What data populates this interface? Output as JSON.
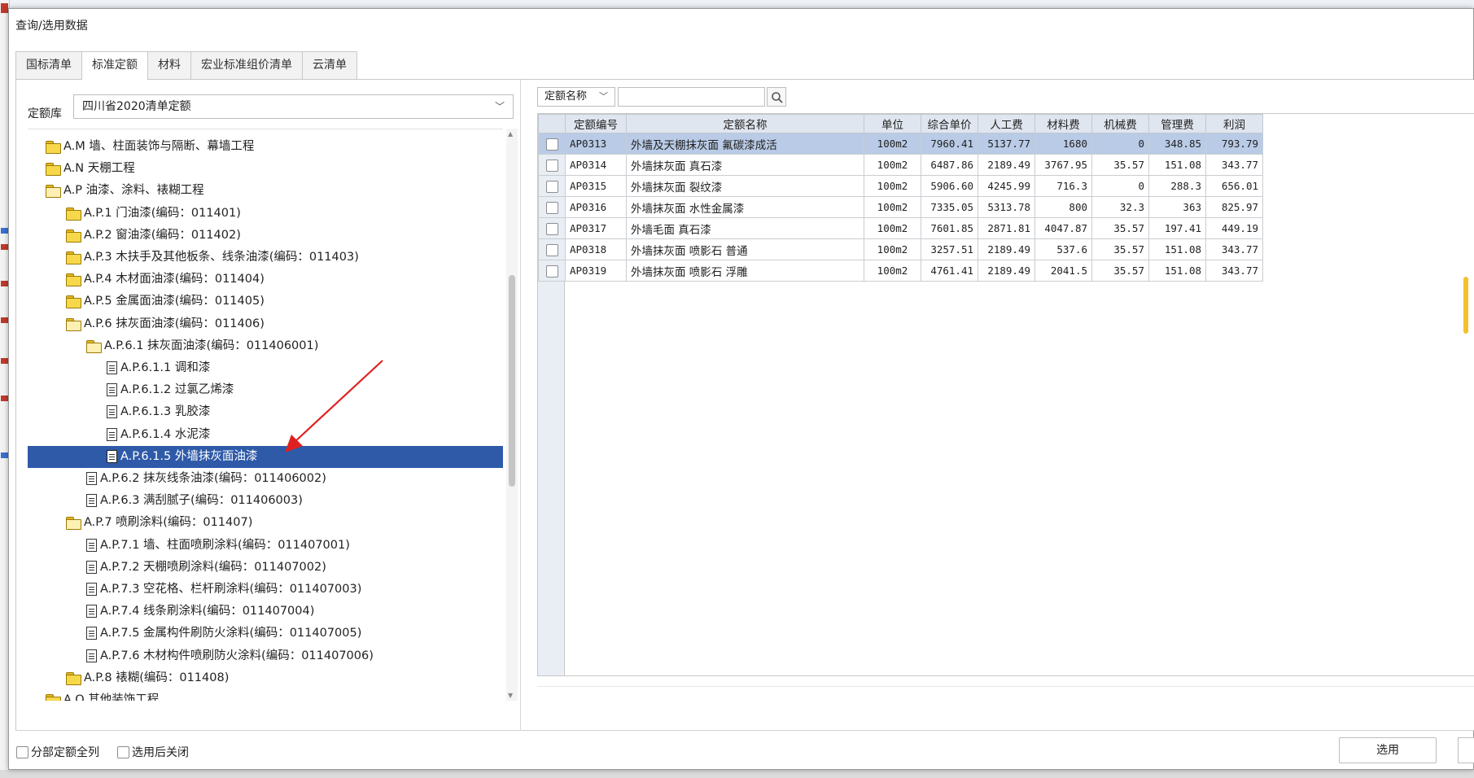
{
  "dialog": {
    "title": "查询/选用数据",
    "tabs": [
      "国标清单",
      "标准定额",
      "材料",
      "宏业标准组价清单",
      "云清单"
    ],
    "active_tab": 1
  },
  "left": {
    "lib_label": "定额库",
    "lib_value": "四川省2020清单定额",
    "tree": [
      {
        "label": "A.M 墙、柱面装饰与隔断、幕墙工程",
        "icon": "folder-closed-icon",
        "level": 1
      },
      {
        "label": "A.N 天棚工程",
        "icon": "folder-closed-icon",
        "level": 1
      },
      {
        "label": "A.P 油漆、涂料、裱糊工程",
        "icon": "folder-open-icon",
        "level": 1
      },
      {
        "label": "A.P.1 门油漆(编码：011401)",
        "icon": "folder-closed-icon",
        "level": 2
      },
      {
        "label": "A.P.2 窗油漆(编码：011402)",
        "icon": "folder-closed-icon",
        "level": 2
      },
      {
        "label": "A.P.3 木扶手及其他板条、线条油漆(编码：011403)",
        "icon": "folder-closed-icon",
        "level": 2
      },
      {
        "label": "A.P.4 木材面油漆(编码：011404)",
        "icon": "folder-closed-icon",
        "level": 2
      },
      {
        "label": "A.P.5 金属面油漆(编码：011405)",
        "icon": "folder-closed-icon",
        "level": 2
      },
      {
        "label": "A.P.6 抹灰面油漆(编码：011406)",
        "icon": "folder-open-icon",
        "level": 2
      },
      {
        "label": "A.P.6.1 抹灰面油漆(编码：011406001)",
        "icon": "folder-open-icon",
        "level": 3
      },
      {
        "label": "A.P.6.1.1 调和漆",
        "icon": "document-icon",
        "level": 4
      },
      {
        "label": "A.P.6.1.2 过氯乙烯漆",
        "icon": "document-icon",
        "level": 4
      },
      {
        "label": "A.P.6.1.3 乳胶漆",
        "icon": "document-icon",
        "level": 4
      },
      {
        "label": "A.P.6.1.4 水泥漆",
        "icon": "document-icon",
        "level": 4
      },
      {
        "label": "A.P.6.1.5 外墙抹灰面油漆",
        "icon": "document-icon",
        "level": 4,
        "selected": true
      },
      {
        "label": "A.P.6.2 抹灰线条油漆(编码：011406002)",
        "icon": "document-icon",
        "level": 3
      },
      {
        "label": "A.P.6.3 满刮腻子(编码：011406003)",
        "icon": "document-icon",
        "level": 3
      },
      {
        "label": "A.P.7 喷刷涂料(编码：011407)",
        "icon": "folder-open-icon",
        "level": 2
      },
      {
        "label": "A.P.7.1 墙、柱面喷刷涂料(编码：011407001)",
        "icon": "document-icon",
        "level": 3
      },
      {
        "label": "A.P.7.2 天棚喷刷涂料(编码：011407002)",
        "icon": "document-icon",
        "level": 3
      },
      {
        "label": "A.P.7.3 空花格、栏杆刷涂料(编码：011407003)",
        "icon": "document-icon",
        "level": 3
      },
      {
        "label": "A.P.7.4 线条刷涂料(编码：011407004)",
        "icon": "document-icon",
        "level": 3
      },
      {
        "label": "A.P.7.5 金属构件刷防火涂料(编码：011407005)",
        "icon": "document-icon",
        "level": 3
      },
      {
        "label": "A.P.7.6 木材构件喷刷防火涂料(编码：011407006)",
        "icon": "document-icon",
        "level": 3
      },
      {
        "label": "A.P.8 裱糊(编码：011408)",
        "icon": "folder-closed-icon",
        "level": 2
      },
      {
        "label": "A.Q 其他装饰工程",
        "icon": "folder-closed-icon",
        "level": 1
      }
    ]
  },
  "right": {
    "filter_value": "定额名称",
    "search_value": "",
    "columns": [
      "定额编号",
      "定额名称",
      "单位",
      "综合单价",
      "人工费",
      "材料费",
      "机械费",
      "管理费",
      "利润"
    ],
    "rows": [
      [
        "AP0313",
        "外墙及天棚抹灰面 氟碳漆成活",
        "100m2",
        "7960.41",
        "5137.77",
        "1680",
        "0",
        "348.85",
        "793.79"
      ],
      [
        "AP0314",
        "外墙抹灰面 真石漆",
        "100m2",
        "6487.86",
        "2189.49",
        "3767.95",
        "35.57",
        "151.08",
        "343.77"
      ],
      [
        "AP0315",
        "外墙抹灰面 裂纹漆",
        "100m2",
        "5906.60",
        "4245.99",
        "716.3",
        "0",
        "288.3",
        "656.01"
      ],
      [
        "AP0316",
        "外墙抹灰面 水性金属漆",
        "100m2",
        "7335.05",
        "5313.78",
        "800",
        "32.3",
        "363",
        "825.97"
      ],
      [
        "AP0317",
        "外墙毛面 真石漆",
        "100m2",
        "7601.85",
        "2871.81",
        "4047.87",
        "35.57",
        "197.41",
        "449.19"
      ],
      [
        "AP0318",
        "外墙抹灰面 喷影石 普通",
        "100m2",
        "3257.51",
        "2189.49",
        "537.6",
        "35.57",
        "151.08",
        "343.77"
      ],
      [
        "AP0319",
        "外墙抹灰面 喷影石 浮雕",
        "100m2",
        "4761.41",
        "2189.49",
        "2041.5",
        "35.57",
        "151.08",
        "343.77"
      ]
    ],
    "selected_row": 0
  },
  "footer": {
    "cb_all_label": "分部定额全列",
    "cb_close_label": "选用后关闭",
    "select_button": "选用"
  },
  "colors": {
    "selection": "#2e5aa8",
    "row_selected": "#b9cbe6",
    "header_bg": "#dfe6ef",
    "arrow": "#e02020"
  }
}
